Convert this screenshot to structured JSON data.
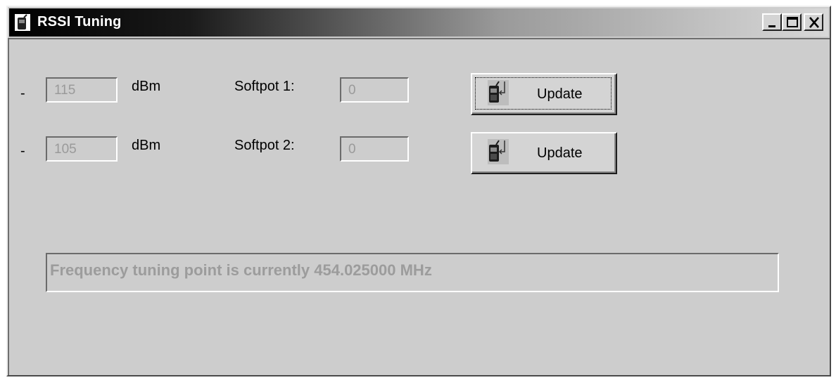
{
  "window": {
    "title": "RSSI Tuning",
    "icons": {
      "title": "radio-icon",
      "minimize": "minimize-icon",
      "maximize": "maximize-icon",
      "close": "close-icon"
    }
  },
  "rows": [
    {
      "sign": "-",
      "level": "115",
      "unit": "dBm",
      "softpot_label": "Softpot 1:",
      "softpot_value": "0",
      "button_label": "Update"
    },
    {
      "sign": "-",
      "level": "105",
      "unit": "dBm",
      "softpot_label": "Softpot 2:",
      "softpot_value": "0",
      "button_label": "Update"
    }
  ],
  "status": {
    "text": "Frequency tuning point is currently 454.025000 MHz"
  },
  "colors": {
    "window_bg": "#cdcdcd",
    "disabled_text": "#9a9a9a",
    "title_text": "#ffffff"
  }
}
